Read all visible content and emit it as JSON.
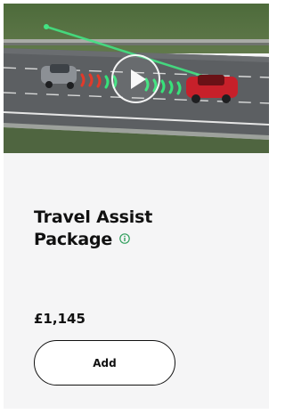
{
  "card": {
    "video": {
      "play_icon": "play-icon",
      "description_icon": "travel-assist-scene"
    },
    "title_line1": "Travel Assist",
    "title_line2": "Package",
    "info_icon": "info-icon",
    "price": "£1,145",
    "add_label": "Add"
  },
  "colors": {
    "text": "#111111",
    "card_bg": "#f5f5f6",
    "info_accent": "#2e9e5b",
    "sensor_green": "#37e27a",
    "sensor_red": "#e23a2a"
  }
}
